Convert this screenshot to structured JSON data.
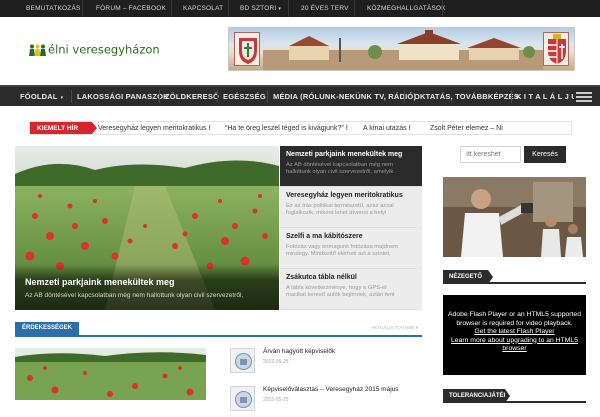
{
  "topbar": {
    "items": [
      {
        "label": "Bemutatkozás",
        "caret": ""
      },
      {
        "label": "Fórum – Facebook",
        "caret": ""
      },
      {
        "label": "Kapcsolat",
        "caret": ""
      },
      {
        "label": "BD Sztori",
        "caret": "▾"
      },
      {
        "label": "20 éves terv",
        "caret": ""
      },
      {
        "label": "Közmeghallgatások",
        "caret": ""
      }
    ]
  },
  "header": {
    "logo_text": "élni veresegyházon"
  },
  "nav": {
    "items": [
      {
        "label": "Főoldal",
        "caret": "▾"
      },
      {
        "label": "Lakossági panaszok",
        "caret": ""
      },
      {
        "label": "Zöldkereső",
        "caret": ""
      },
      {
        "label": "Egészség",
        "caret": ""
      },
      {
        "label": "Média (Rólunk-nekünk TV, Rádió)",
        "caret": ""
      },
      {
        "label": "Oktatás, továbbképzés",
        "caret": ""
      },
      {
        "label": "K I T A L Á L J U K",
        "caret": ""
      }
    ]
  },
  "ticker": {
    "label": "Kiemelt hír",
    "items": [
      "Veresegyház legyen meritokratikus",
      "“Ha te öreg leszel téged is kivágjunk?”",
      "A kínai utazás",
      "Zsolt Péter elemez – Ni"
    ]
  },
  "featured": {
    "title": "Nemzeti parkjaink menekültek meg",
    "excerpt": "Az AB döntésével kapcsolatban még nem hallottunk olyan civil szervezetről,"
  },
  "slider_list": [
    {
      "title": "Nemzeti parkjaink menekültek meg",
      "excerpt_1": "Az AB döntésével kapcsolatban még nem",
      "excerpt_2": "hallottunk olyan civil szervezetről, amelyik",
      "active": true
    },
    {
      "title": "Veresegyház legyen meritokratikus",
      "excerpt_1": "Ez az írás politikai természetű, azaz azzal",
      "excerpt_2": "foglalkozik, miként lehet átvenni a helyi",
      "active": false
    },
    {
      "title": "Szelfi a ma kábítószere",
      "excerpt_1": "Fotózás vagy önmagunk fotózása majdnem",
      "excerpt_2": "mindegy. Mindkettő elérheti azt a szintet,",
      "active": false
    },
    {
      "title": "Zsákutca tábla nélkül",
      "excerpt_1": "A tábla következménye, hogy a GPS-el",
      "excerpt_2": "macikat kereső autók bejönnek, aztán fent",
      "active": false
    }
  ],
  "section": {
    "label": "Érdekességek",
    "more": "Aktuális további ▾"
  },
  "posts": [
    {
      "title": "Árván hagyott képviselők",
      "date": "2015-05-25"
    },
    {
      "title": "Képviselőválasztás – Veresegyház 2015 május",
      "date": "2015-05-25"
    }
  ],
  "search": {
    "placeholder": "ítt kereshet",
    "button": "Keresés"
  },
  "widgets": {
    "viewer_label": "Nézegető",
    "tolerance_label": "Toleranciajáték"
  },
  "flash": {
    "line1": "Adobe Flash Player or an HTML5 supported",
    "line2": "browser is required for video playback.",
    "link1": "Get the latest Flash Player",
    "link2a": "Learn more about upgrading to an HTML5",
    "link2b": "browser"
  },
  "colors": {
    "accent_red": "#d8262f",
    "accent_blue": "#2a6faa",
    "nav_dark": "#2b2b2b",
    "logo_green": "#2a6d1f"
  }
}
